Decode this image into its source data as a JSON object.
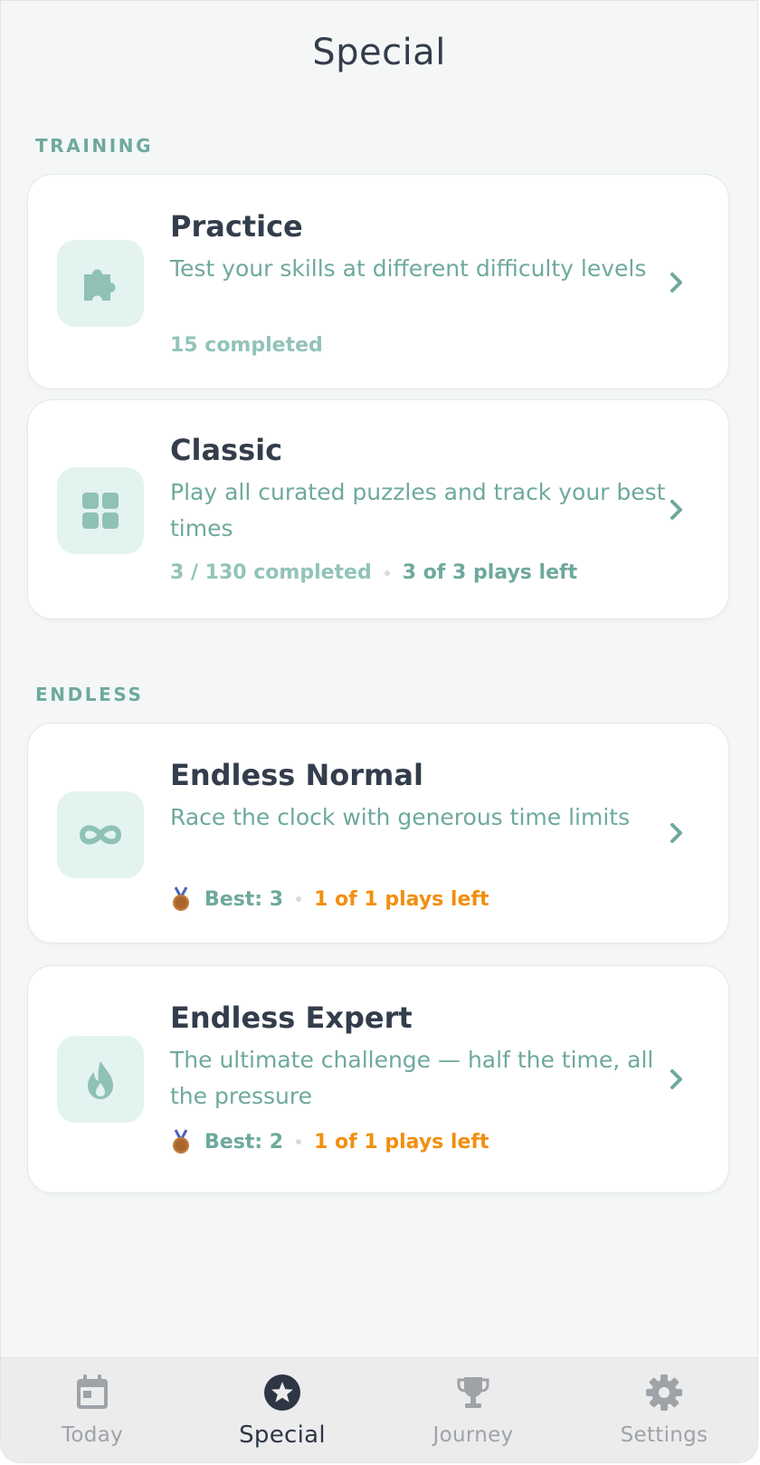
{
  "header": {
    "title": "Special"
  },
  "sections": [
    {
      "label": "TRAINING",
      "cards": [
        {
          "title": "Practice",
          "description": "Test your skills at different difficulty levels",
          "icon": "puzzle-icon",
          "meta": {
            "completed": "15 completed"
          }
        },
        {
          "title": "Classic",
          "description": "Play all curated puzzles and track your best times",
          "icon": "grid-icon",
          "meta": {
            "completed": "3 / 130 completed",
            "plays_left": "3 of 3 plays left"
          }
        }
      ]
    },
    {
      "label": "ENDLESS",
      "cards": [
        {
          "title": "Endless Normal",
          "description": "Race the clock with generous time limits",
          "icon": "infinity-icon",
          "meta": {
            "medal": "bronze-medal-icon",
            "best": "Best: 3",
            "plays_left": "1 of 1 plays left"
          }
        },
        {
          "title": "Endless Expert",
          "description": "The ultimate challenge — half the time, all the pressure",
          "icon": "flame-icon",
          "meta": {
            "medal": "bronze-medal-icon",
            "best": "Best: 2",
            "plays_left": "1 of 1 plays left"
          }
        }
      ]
    }
  ],
  "tabbar": {
    "tabs": [
      {
        "label": "Today",
        "icon": "calendar-icon",
        "active": false
      },
      {
        "label": "Special",
        "icon": "star-icon",
        "active": true
      },
      {
        "label": "Journey",
        "icon": "trophy-icon",
        "active": false
      },
      {
        "label": "Settings",
        "icon": "gear-icon",
        "active": false
      }
    ]
  },
  "colors": {
    "accent": "#6ea99d",
    "icon_tile": "#e3f3f0",
    "plays_left_endless": "#f28f10",
    "title_text": "#333d4c"
  }
}
